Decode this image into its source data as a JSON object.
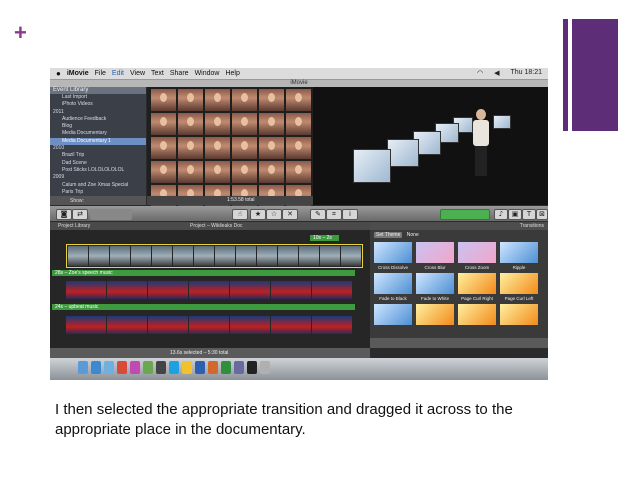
{
  "slide": {
    "caption": "I then selected the appropriate transition and dragged it across to the appropriate place in the documentary.",
    "accent_color": "#5d2d78"
  },
  "screenshot": {
    "menubar": {
      "app": "iMovie",
      "items": [
        "File",
        "Edit",
        "View",
        "Text",
        "Share",
        "Window",
        "Help"
      ],
      "clock": "Thu 18:21"
    },
    "window_title": "iMovie",
    "event_library": {
      "header": "Event Library",
      "items": [
        {
          "label": "Last Import",
          "selected": false
        },
        {
          "label": "iPhoto Videos",
          "selected": false
        },
        {
          "label": "2011",
          "selected": false
        },
        {
          "label": "Audience Feedback",
          "selected": false
        },
        {
          "label": "Blog",
          "selected": false
        },
        {
          "label": "Media Documentary",
          "selected": false
        },
        {
          "label": "Media Documentary 1",
          "selected": true
        },
        {
          "label": "2010",
          "selected": false
        },
        {
          "label": "Brazil Trip",
          "selected": false
        },
        {
          "label": "Dad Scene",
          "selected": false
        },
        {
          "label": "Post Sticks LOLOLOLOLOL",
          "selected": false
        },
        {
          "label": "2009",
          "selected": false
        },
        {
          "label": "Calum and Zoe Xmas Special",
          "selected": false
        },
        {
          "label": "Paris Trip",
          "selected": false
        }
      ],
      "show_label": "Show:"
    },
    "event_browser": {
      "duration": "1:53.58 total"
    },
    "project": {
      "library_label": "Project Library",
      "title": "Project – Wikileaks Doc",
      "clip_tag": "10s – 2s",
      "music_tracks": [
        "28s – Zoe's speech music",
        "24s – upbeat music"
      ],
      "total": "13.6s selected – 5:30 total"
    },
    "transitions": {
      "header": "Transitions",
      "theme_button": "Set Theme",
      "theme_value": "None",
      "items": [
        {
          "label": "Cross Dissolve",
          "style": "blue"
        },
        {
          "label": "Cross Blur",
          "style": "pink"
        },
        {
          "label": "Cross Zoom",
          "style": "pink"
        },
        {
          "label": "Ripple",
          "style": "blue"
        },
        {
          "label": "Fade to Black",
          "style": "blue"
        },
        {
          "label": "Fade to White",
          "style": "blue"
        },
        {
          "label": "Page Curl Right",
          "style": "orange"
        },
        {
          "label": "Page Curl Left",
          "style": "orange"
        },
        {
          "label": "",
          "style": "blue"
        },
        {
          "label": "",
          "style": "orange"
        },
        {
          "label": "",
          "style": "orange"
        },
        {
          "label": "",
          "style": "orange"
        }
      ]
    },
    "dock_icons": [
      "finder",
      "safari",
      "mail",
      "ical",
      "itunes",
      "iphoto",
      "imovie",
      "skype",
      "chrome",
      "word",
      "powerpoint",
      "excel",
      "preview",
      "terminal",
      "trash"
    ]
  }
}
